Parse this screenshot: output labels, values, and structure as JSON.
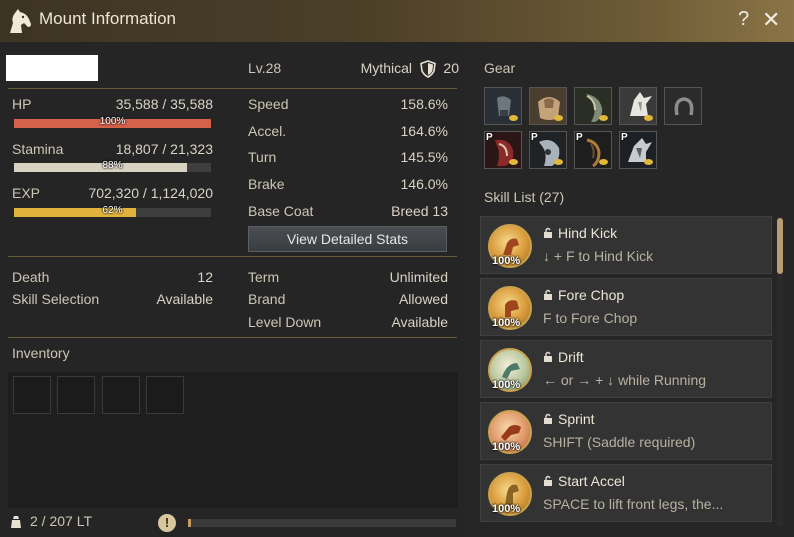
{
  "window": {
    "title": "Mount Information",
    "help_label": "?",
    "close_label": "✕"
  },
  "mount": {
    "level": "Lv.28",
    "grade": "Mythical",
    "tier": "20"
  },
  "stats": [
    {
      "label": "HP",
      "value": "35,588 / 35,588",
      "percent_label": "100%",
      "fraction": 1.0,
      "color": "#d4614a"
    },
    {
      "label": "Stamina",
      "value": "18,807 / 21,323",
      "percent_label": "88%",
      "fraction": 0.88,
      "color": "#d8d2c0"
    },
    {
      "label": "EXP",
      "value": "702,320 / 1,124,020",
      "percent_label": "62%",
      "fraction": 0.62,
      "color": "#e2b33c"
    }
  ],
  "attributes": [
    {
      "label": "Speed",
      "value": "158.6%"
    },
    {
      "label": "Accel.",
      "value": "164.6%"
    },
    {
      "label": "Turn",
      "value": "145.5%"
    },
    {
      "label": "Brake",
      "value": "146.0%"
    },
    {
      "label": "Base Coat",
      "value": "Breed 13"
    }
  ],
  "view_detailed_label": "View Detailed Stats",
  "info_left": [
    {
      "label": "Death",
      "value": "12"
    },
    {
      "label": "Skill Selection",
      "value": "Available"
    }
  ],
  "info_right": [
    {
      "label": "Term",
      "value": "Unlimited"
    },
    {
      "label": "Brand",
      "value": "Allowed"
    },
    {
      "label": "Level Down",
      "value": "Available"
    }
  ],
  "inventory": {
    "title": "Inventory",
    "weight": "2 / 207 LT",
    "warn_label": "!",
    "progress_fraction": 0.01
  },
  "gear": {
    "title": "Gear",
    "slots": [
      {
        "icon": "stirrup-icon",
        "premium": false
      },
      {
        "icon": "saddle-icon",
        "premium": false
      },
      {
        "icon": "horse-armor-icon",
        "premium": false
      },
      {
        "icon": "horse-helm-icon",
        "premium": false
      },
      {
        "icon": "horseshoe-icon",
        "premium": false
      },
      {
        "icon": "premium-armor-red-icon",
        "premium": true
      },
      {
        "icon": "premium-armor-silver-icon",
        "premium": true
      },
      {
        "icon": "premium-saddle-icon",
        "premium": true
      },
      {
        "icon": "premium-helm-icon",
        "premium": true
      }
    ],
    "premium_badge": "P"
  },
  "skills": {
    "title": "Skill List (27)",
    "items": [
      {
        "name": "Hind Kick",
        "desc": "↓ + F to Hind Kick",
        "level": "100%",
        "icon": "hind-kick-icon"
      },
      {
        "name": "Fore Chop",
        "desc": "F to Fore Chop",
        "level": "100%",
        "icon": "fore-chop-icon"
      },
      {
        "name": "Drift",
        "desc": "← or → + ↓ while Running",
        "level": "100%",
        "icon": "drift-icon"
      },
      {
        "name": "Sprint",
        "desc": "SHIFT (Saddle required)",
        "level": "100%",
        "icon": "sprint-icon"
      },
      {
        "name": "Start Accel",
        "desc": "SPACE to lift front legs, the...",
        "level": "100%",
        "icon": "start-accel-icon"
      }
    ]
  },
  "colors": {
    "accent": "#6a5a3c",
    "title_gold": "#8a7446",
    "scroll_thumb": "#b89c72"
  }
}
